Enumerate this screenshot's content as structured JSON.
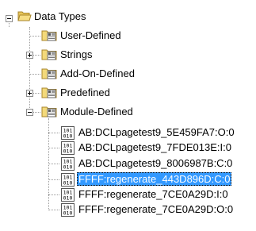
{
  "tree": {
    "root": {
      "label": "Data Types",
      "expanded": true,
      "icon": "folder-open-icon"
    },
    "children": [
      {
        "label": "User-Defined",
        "icon": "datatype-folder-icon",
        "expander": null
      },
      {
        "label": "Strings",
        "icon": "datatype-folder-icon",
        "expander": "collapsed"
      },
      {
        "label": "Add-On-Defined",
        "icon": "datatype-folder-icon",
        "expander": null
      },
      {
        "label": "Predefined",
        "icon": "datatype-folder-icon",
        "expander": "collapsed"
      },
      {
        "label": "Module-Defined",
        "icon": "datatype-folder-icon",
        "expander": "expanded"
      }
    ],
    "module_defined_items": [
      {
        "label": "AB:DCLpagetest9_5E459FA7:O:0",
        "icon": "binary-datatype-icon",
        "selected": false
      },
      {
        "label": "AB:DCLpagetest9_7FDE013E:I:0",
        "icon": "binary-datatype-icon",
        "selected": false
      },
      {
        "label": "AB:DCLpagetest9_8006987B:C:0",
        "icon": "binary-datatype-icon",
        "selected": false
      },
      {
        "label": "FFFF:regenerate_443D896D:C:0",
        "icon": "binary-datatype-icon",
        "selected": true
      },
      {
        "label": "FFFF:regenerate_7CE0A29D:I:0",
        "icon": "binary-datatype-icon",
        "selected": false
      },
      {
        "label": "FFFF:regenerate_7CE0A29D:O:0",
        "icon": "binary-datatype-icon",
        "selected": false
      }
    ]
  },
  "colors": {
    "selection": "#3399ff",
    "folder": "#f3d97a",
    "tree_lines": "#9a9a9a"
  }
}
